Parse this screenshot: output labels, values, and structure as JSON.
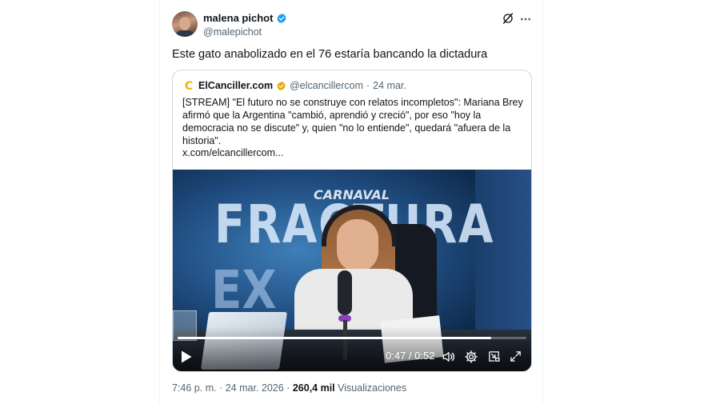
{
  "tweet": {
    "author_name": "malena pichot",
    "author_handle": "@malepichot",
    "text": "Este gato anabolizado en el 76 estaría bancando la dictadura",
    "time": "7:46 p. m.",
    "separator": "·",
    "date": "24 mar. 2026",
    "views_count": "260,4 mil",
    "views_label": "Visualizaciones",
    "icons": {
      "verified": "verified-badge-icon",
      "grok": "grok-icon",
      "more": "more-options-icon"
    },
    "colors": {
      "verified": "#1d9bf0",
      "secondary_text": "#536471",
      "border": "#cfd9de"
    }
  },
  "quoted": {
    "logo_letter": "C",
    "author_name": "ElCanciller.com",
    "author_handle": "@elcancillercom",
    "separator": "·",
    "date": "24 mar.",
    "text": "[STREAM] \"El futuro no se construye con relatos incompletos\": Mariana Brey afirmó que la Argentina \"cambió, aprendió y creció\", por eso \"hoy la democracia no se discute\" y, quien \"no lo entiende\", quedará \"afuera de la historia\".",
    "link": "x.com/elcancillercom...",
    "colors": {
      "logo": "#f2b400",
      "badge": "#e8a800"
    }
  },
  "video": {
    "brand_text": "CARNAVAL",
    "background_text_1": "FRACTURA",
    "background_text_2": "EX",
    "time": "0:47 / 0:52",
    "progress": 0.9,
    "controls": [
      "play-icon",
      "volume-icon",
      "settings-icon",
      "picture-in-picture-icon",
      "fullscreen-icon"
    ]
  }
}
